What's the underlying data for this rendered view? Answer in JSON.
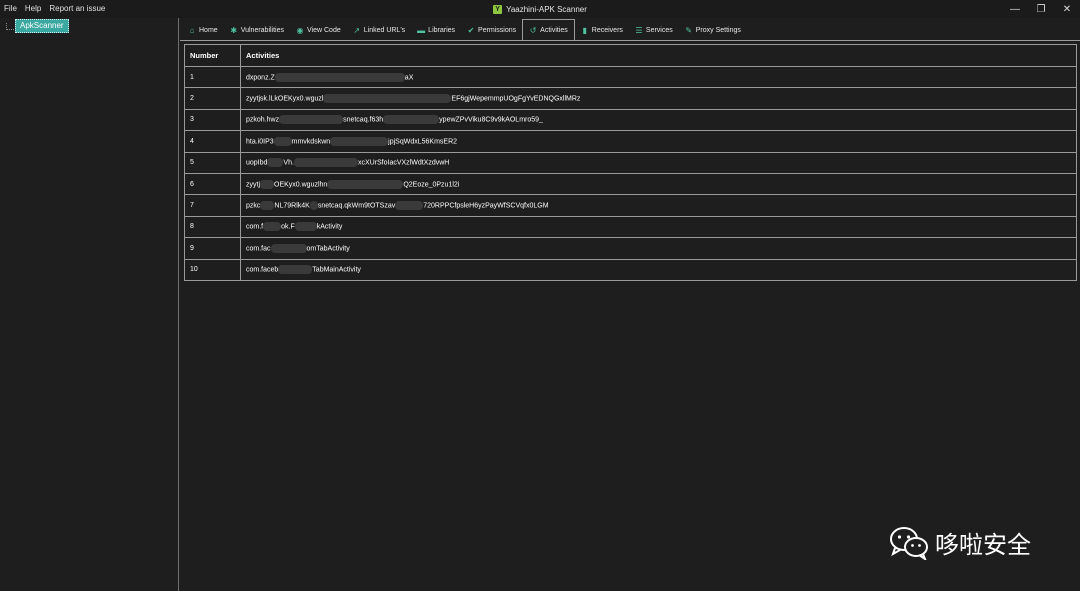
{
  "window": {
    "title": "Yaazhini-APK Scanner",
    "icon_letter": "Y",
    "menu": [
      "File",
      "Help",
      "Report an issue"
    ],
    "controls": {
      "minimize": "—",
      "restore": "❐",
      "close": "✕"
    }
  },
  "tree": {
    "root_label": "ApkScanner"
  },
  "tabs": [
    {
      "label": "Home",
      "icon": "home-icon",
      "glyph": "⌂"
    },
    {
      "label": "Vulnerabilities",
      "icon": "bug-icon",
      "glyph": "✱"
    },
    {
      "label": "View Code",
      "icon": "eye-icon",
      "glyph": "◉"
    },
    {
      "label": "Linked URL's",
      "icon": "external-link-icon",
      "glyph": "↗"
    },
    {
      "label": "Libraries",
      "icon": "folder-icon",
      "glyph": "▬"
    },
    {
      "label": "Permissions",
      "icon": "check-icon",
      "glyph": "✔"
    },
    {
      "label": "Activities",
      "icon": "undo-icon",
      "glyph": "↺"
    },
    {
      "label": "Receivers",
      "icon": "signal-icon",
      "glyph": "▮"
    },
    {
      "label": "Services",
      "icon": "list-icon",
      "glyph": "☰"
    },
    {
      "label": "Proxy Settings",
      "icon": "wrench-icon",
      "glyph": "✎"
    }
  ],
  "active_tab": "Activities",
  "table": {
    "headers": [
      "Number",
      "Activities"
    ],
    "rows": [
      {
        "number": "1",
        "activity_start": "dxponz.Z",
        "activity_end": "aX"
      },
      {
        "number": "2",
        "activity_start": "zyytjsk.lLkOEKyx0.wguzl",
        "activity_end": "EF6gjWepemmpUOgFgYvEDNQGxllMRz"
      },
      {
        "number": "3",
        "activity_start": "pzkoh.hwz",
        "activity_end": "snetcaq.f63h",
        "activity_tail": "ypewZPvViku8C9v9kAOLmro59_"
      },
      {
        "number": "4",
        "activity_start": "hta.i0IP3",
        "activity_end": "mmvkdskwn",
        "activity_tail": "jpjSqWdxL56KmsER2"
      },
      {
        "number": "5",
        "activity_start": "uopIbd",
        "activity_end": "Vh.",
        "activity_tail": "xcXUrSfoIacVXzlWdtXzdvwH"
      },
      {
        "number": "6",
        "activity_start": "zyytj",
        "activity_end": "OEKyx0.wguzlhn",
        "activity_tail": "Q2Eoze_0Pzu1l2i"
      },
      {
        "number": "7",
        "activity_start": "pzkc",
        "activity_end": "NL79Rlk4K",
        "activity_tail": "snetcaq.qkWm9tOTSzav",
        "activity_tail2": "720RPPCfpsleH6yzPayWfSCVqfx0LGM"
      },
      {
        "number": "8",
        "activity_start": "com.f",
        "activity_end": "ok.F",
        "activity_tail": "kActivity"
      },
      {
        "number": "9",
        "activity_start": "com.fac",
        "activity_end": "omTabActivity"
      },
      {
        "number": "10",
        "activity_start": "com.faceb",
        "activity_end": "TabMainActivity"
      }
    ]
  },
  "watermark": {
    "text": "哆啦安全",
    "icon": "wechat-icon"
  },
  "colors": {
    "accent": "#4fc3a1",
    "tree_selected": "#3aa8a0",
    "background": "#1e1e1e",
    "border": "#9a9a9a"
  }
}
